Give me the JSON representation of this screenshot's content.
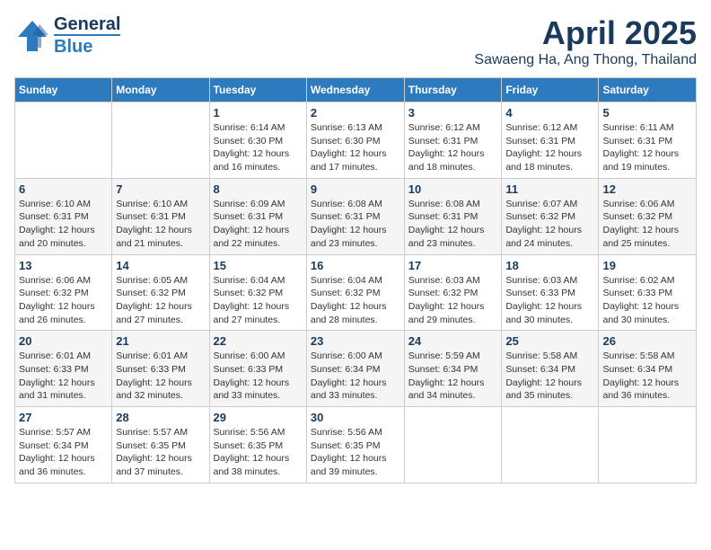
{
  "logo": {
    "line1": "General",
    "line2": "Blue"
  },
  "title": "April 2025",
  "location": "Sawaeng Ha, Ang Thong, Thailand",
  "days_of_week": [
    "Sunday",
    "Monday",
    "Tuesday",
    "Wednesday",
    "Thursday",
    "Friday",
    "Saturday"
  ],
  "weeks": [
    [
      {
        "day": "",
        "info": ""
      },
      {
        "day": "",
        "info": ""
      },
      {
        "day": "1",
        "info": "Sunrise: 6:14 AM\nSunset: 6:30 PM\nDaylight: 12 hours and 16 minutes."
      },
      {
        "day": "2",
        "info": "Sunrise: 6:13 AM\nSunset: 6:30 PM\nDaylight: 12 hours and 17 minutes."
      },
      {
        "day": "3",
        "info": "Sunrise: 6:12 AM\nSunset: 6:31 PM\nDaylight: 12 hours and 18 minutes."
      },
      {
        "day": "4",
        "info": "Sunrise: 6:12 AM\nSunset: 6:31 PM\nDaylight: 12 hours and 18 minutes."
      },
      {
        "day": "5",
        "info": "Sunrise: 6:11 AM\nSunset: 6:31 PM\nDaylight: 12 hours and 19 minutes."
      }
    ],
    [
      {
        "day": "6",
        "info": "Sunrise: 6:10 AM\nSunset: 6:31 PM\nDaylight: 12 hours and 20 minutes."
      },
      {
        "day": "7",
        "info": "Sunrise: 6:10 AM\nSunset: 6:31 PM\nDaylight: 12 hours and 21 minutes."
      },
      {
        "day": "8",
        "info": "Sunrise: 6:09 AM\nSunset: 6:31 PM\nDaylight: 12 hours and 22 minutes."
      },
      {
        "day": "9",
        "info": "Sunrise: 6:08 AM\nSunset: 6:31 PM\nDaylight: 12 hours and 23 minutes."
      },
      {
        "day": "10",
        "info": "Sunrise: 6:08 AM\nSunset: 6:31 PM\nDaylight: 12 hours and 23 minutes."
      },
      {
        "day": "11",
        "info": "Sunrise: 6:07 AM\nSunset: 6:32 PM\nDaylight: 12 hours and 24 minutes."
      },
      {
        "day": "12",
        "info": "Sunrise: 6:06 AM\nSunset: 6:32 PM\nDaylight: 12 hours and 25 minutes."
      }
    ],
    [
      {
        "day": "13",
        "info": "Sunrise: 6:06 AM\nSunset: 6:32 PM\nDaylight: 12 hours and 26 minutes."
      },
      {
        "day": "14",
        "info": "Sunrise: 6:05 AM\nSunset: 6:32 PM\nDaylight: 12 hours and 27 minutes."
      },
      {
        "day": "15",
        "info": "Sunrise: 6:04 AM\nSunset: 6:32 PM\nDaylight: 12 hours and 27 minutes."
      },
      {
        "day": "16",
        "info": "Sunrise: 6:04 AM\nSunset: 6:32 PM\nDaylight: 12 hours and 28 minutes."
      },
      {
        "day": "17",
        "info": "Sunrise: 6:03 AM\nSunset: 6:32 PM\nDaylight: 12 hours and 29 minutes."
      },
      {
        "day": "18",
        "info": "Sunrise: 6:03 AM\nSunset: 6:33 PM\nDaylight: 12 hours and 30 minutes."
      },
      {
        "day": "19",
        "info": "Sunrise: 6:02 AM\nSunset: 6:33 PM\nDaylight: 12 hours and 30 minutes."
      }
    ],
    [
      {
        "day": "20",
        "info": "Sunrise: 6:01 AM\nSunset: 6:33 PM\nDaylight: 12 hours and 31 minutes."
      },
      {
        "day": "21",
        "info": "Sunrise: 6:01 AM\nSunset: 6:33 PM\nDaylight: 12 hours and 32 minutes."
      },
      {
        "day": "22",
        "info": "Sunrise: 6:00 AM\nSunset: 6:33 PM\nDaylight: 12 hours and 33 minutes."
      },
      {
        "day": "23",
        "info": "Sunrise: 6:00 AM\nSunset: 6:34 PM\nDaylight: 12 hours and 33 minutes."
      },
      {
        "day": "24",
        "info": "Sunrise: 5:59 AM\nSunset: 6:34 PM\nDaylight: 12 hours and 34 minutes."
      },
      {
        "day": "25",
        "info": "Sunrise: 5:58 AM\nSunset: 6:34 PM\nDaylight: 12 hours and 35 minutes."
      },
      {
        "day": "26",
        "info": "Sunrise: 5:58 AM\nSunset: 6:34 PM\nDaylight: 12 hours and 36 minutes."
      }
    ],
    [
      {
        "day": "27",
        "info": "Sunrise: 5:57 AM\nSunset: 6:34 PM\nDaylight: 12 hours and 36 minutes."
      },
      {
        "day": "28",
        "info": "Sunrise: 5:57 AM\nSunset: 6:35 PM\nDaylight: 12 hours and 37 minutes."
      },
      {
        "day": "29",
        "info": "Sunrise: 5:56 AM\nSunset: 6:35 PM\nDaylight: 12 hours and 38 minutes."
      },
      {
        "day": "30",
        "info": "Sunrise: 5:56 AM\nSunset: 6:35 PM\nDaylight: 12 hours and 39 minutes."
      },
      {
        "day": "",
        "info": ""
      },
      {
        "day": "",
        "info": ""
      },
      {
        "day": "",
        "info": ""
      }
    ]
  ]
}
